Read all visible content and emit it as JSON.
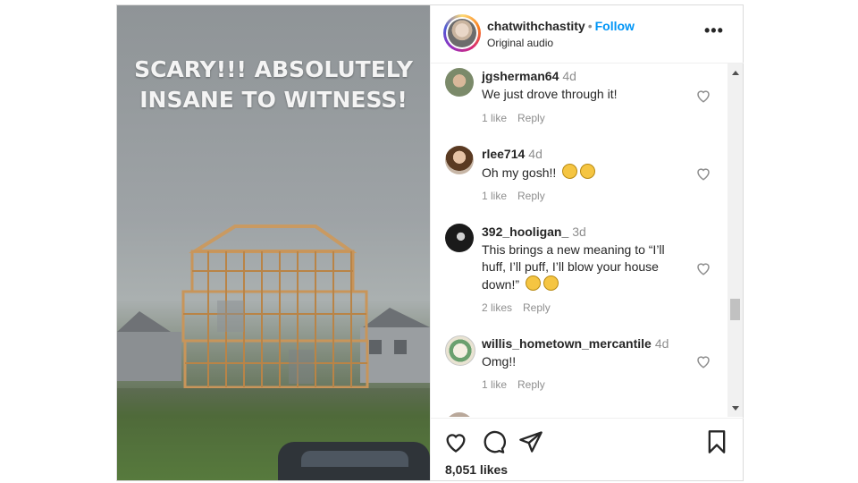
{
  "media": {
    "caption_lines": [
      "SCARY!!! ABSOLUTELY",
      "INSANE TO WITNESS!"
    ]
  },
  "header": {
    "username": "chatwithchastity",
    "separator": "•",
    "follow_label": "Follow",
    "audio_label": "Original audio",
    "more_label": "•••"
  },
  "comments": [
    {
      "username": "jgsherman64",
      "time": "4d",
      "text": "We just drove through it!",
      "likes": "1 like",
      "reply": "Reply"
    },
    {
      "username": "rlee714",
      "time": "4d",
      "text": "Oh my gosh!!",
      "likes": "1 like",
      "reply": "Reply"
    },
    {
      "username": "392_hooligan_",
      "time": "3d",
      "text": "This brings a new meaning to “I’ll huff, I’ll puff, I’ll blow your house down!”",
      "likes": "2 likes",
      "reply": "Reply"
    },
    {
      "username": "willis_hometown_mercantile",
      "time": "4d",
      "text": "Omg!!",
      "likes": "1 like",
      "reply": "Reply"
    }
  ],
  "footer": {
    "likes_count": "8,051 likes"
  },
  "colors": {
    "accent": "#0095f6",
    "muted": "#8e8e8e",
    "text": "#262626"
  }
}
